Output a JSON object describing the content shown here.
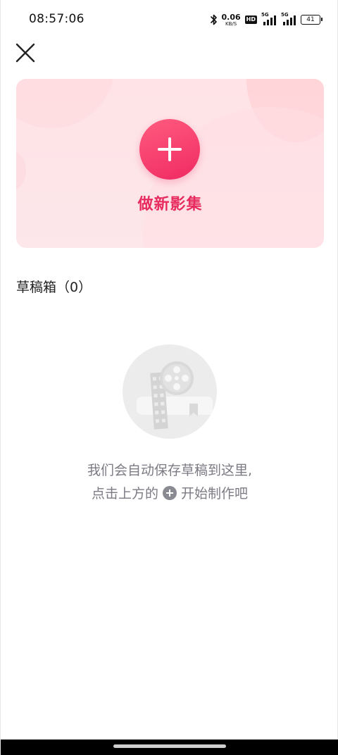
{
  "status_bar": {
    "time": "08:57:06",
    "net_speed_value": "0.06",
    "net_speed_unit": "KB/S",
    "hd_label": "HD",
    "sim1_label": "5G",
    "sim2_label": "5G",
    "battery_level": "41"
  },
  "header": {
    "close_icon": "close-icon"
  },
  "create": {
    "label": "做新影集",
    "icon": "plus-icon",
    "accent_color": "#e82b5e"
  },
  "drafts": {
    "title": "草稿箱（0）",
    "empty_line1": "我们会自动保存草稿到这里,",
    "empty_line2_before": "点击上方的",
    "empty_line2_after": "开始制作吧",
    "illustration_icon": "film-reel-icon"
  }
}
